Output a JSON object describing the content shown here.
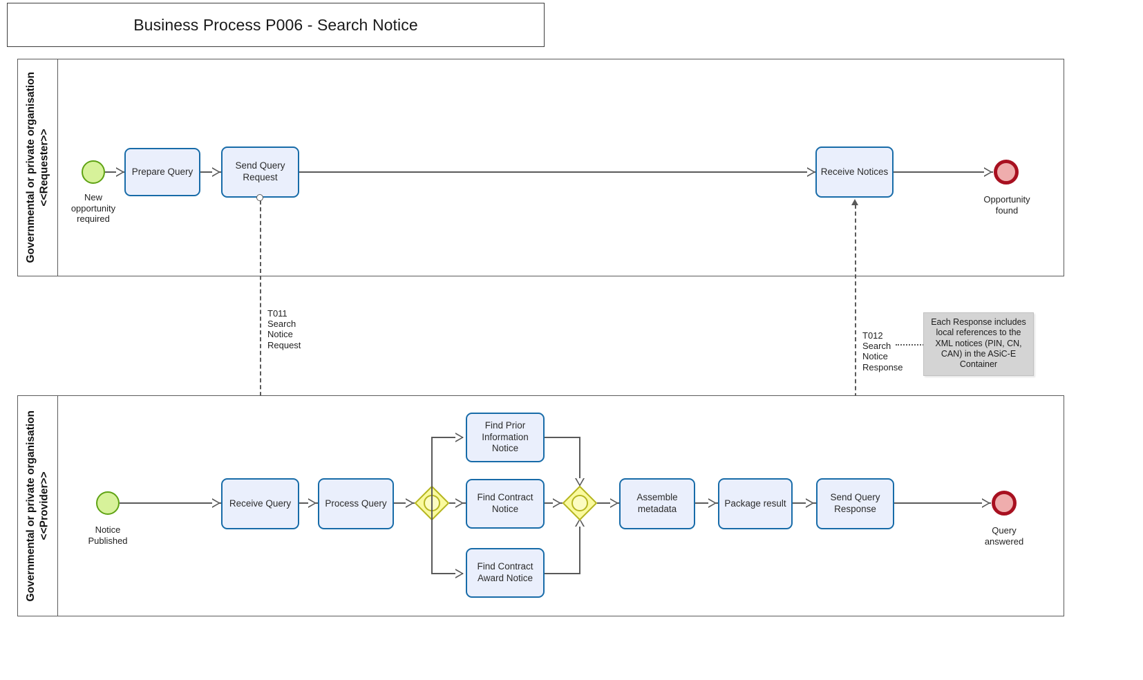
{
  "diagram": {
    "title": "Business Process P006 - Search Notice"
  },
  "lanes": [
    {
      "id": "requester",
      "label": "Governmental or private organisation\n<<Requester>>"
    },
    {
      "id": "provider",
      "label": "Governmental or private organisation\n<<Provider>>"
    }
  ],
  "requester": {
    "start_event_label": "New\nopportunity\nrequired",
    "tasks": [
      {
        "id": "prepare-query",
        "label": "Prepare Query"
      },
      {
        "id": "send-query-request",
        "label": "Send Query\nRequest"
      },
      {
        "id": "receive-notices",
        "label": "Receive Notices"
      }
    ],
    "end_event_label": "Opportunity\nfound"
  },
  "provider": {
    "start_event_label": "Notice\nPublished",
    "tasks": [
      {
        "id": "receive-query",
        "label": "Receive Query"
      },
      {
        "id": "process-query",
        "label": "Process Query"
      },
      {
        "id": "find-prior-information-notice",
        "label": "Find Prior\nInformation\nNotice"
      },
      {
        "id": "find-contract-notice",
        "label": "Find Contract\nNotice"
      },
      {
        "id": "find-contract-award-notice",
        "label": "Find Contract\nAward Notice"
      },
      {
        "id": "assemble-metadata",
        "label": "Assemble\nmetadata"
      },
      {
        "id": "package-result",
        "label": "Package result"
      },
      {
        "id": "send-query-response",
        "label": "Send Query\nResponse"
      }
    ],
    "end_event_label": "Query\nanswered"
  },
  "message_flows": [
    {
      "id": "t011",
      "label": "T011\nSearch\nNotice\nRequest"
    },
    {
      "id": "t012",
      "label": "T012\nSearch\nNotice\nResponse"
    }
  ],
  "annotations": [
    {
      "id": "response-note",
      "text": "Each Response includes local references to the XML notices (PIN, CN, CAN) in the ASiC-E Container"
    }
  ],
  "colors": {
    "task_fill": "#eaeffc",
    "task_border": "#176ba8",
    "start_event_fill": "#d7f29a",
    "start_event_border": "#5fa314",
    "end_event_fill": "#efadad",
    "end_event_border": "#a81020",
    "gateway_fill": "#fafa9e",
    "gateway_border": "#b5b520",
    "connector": "#595959",
    "annotation_fill": "#d4d4d4"
  }
}
